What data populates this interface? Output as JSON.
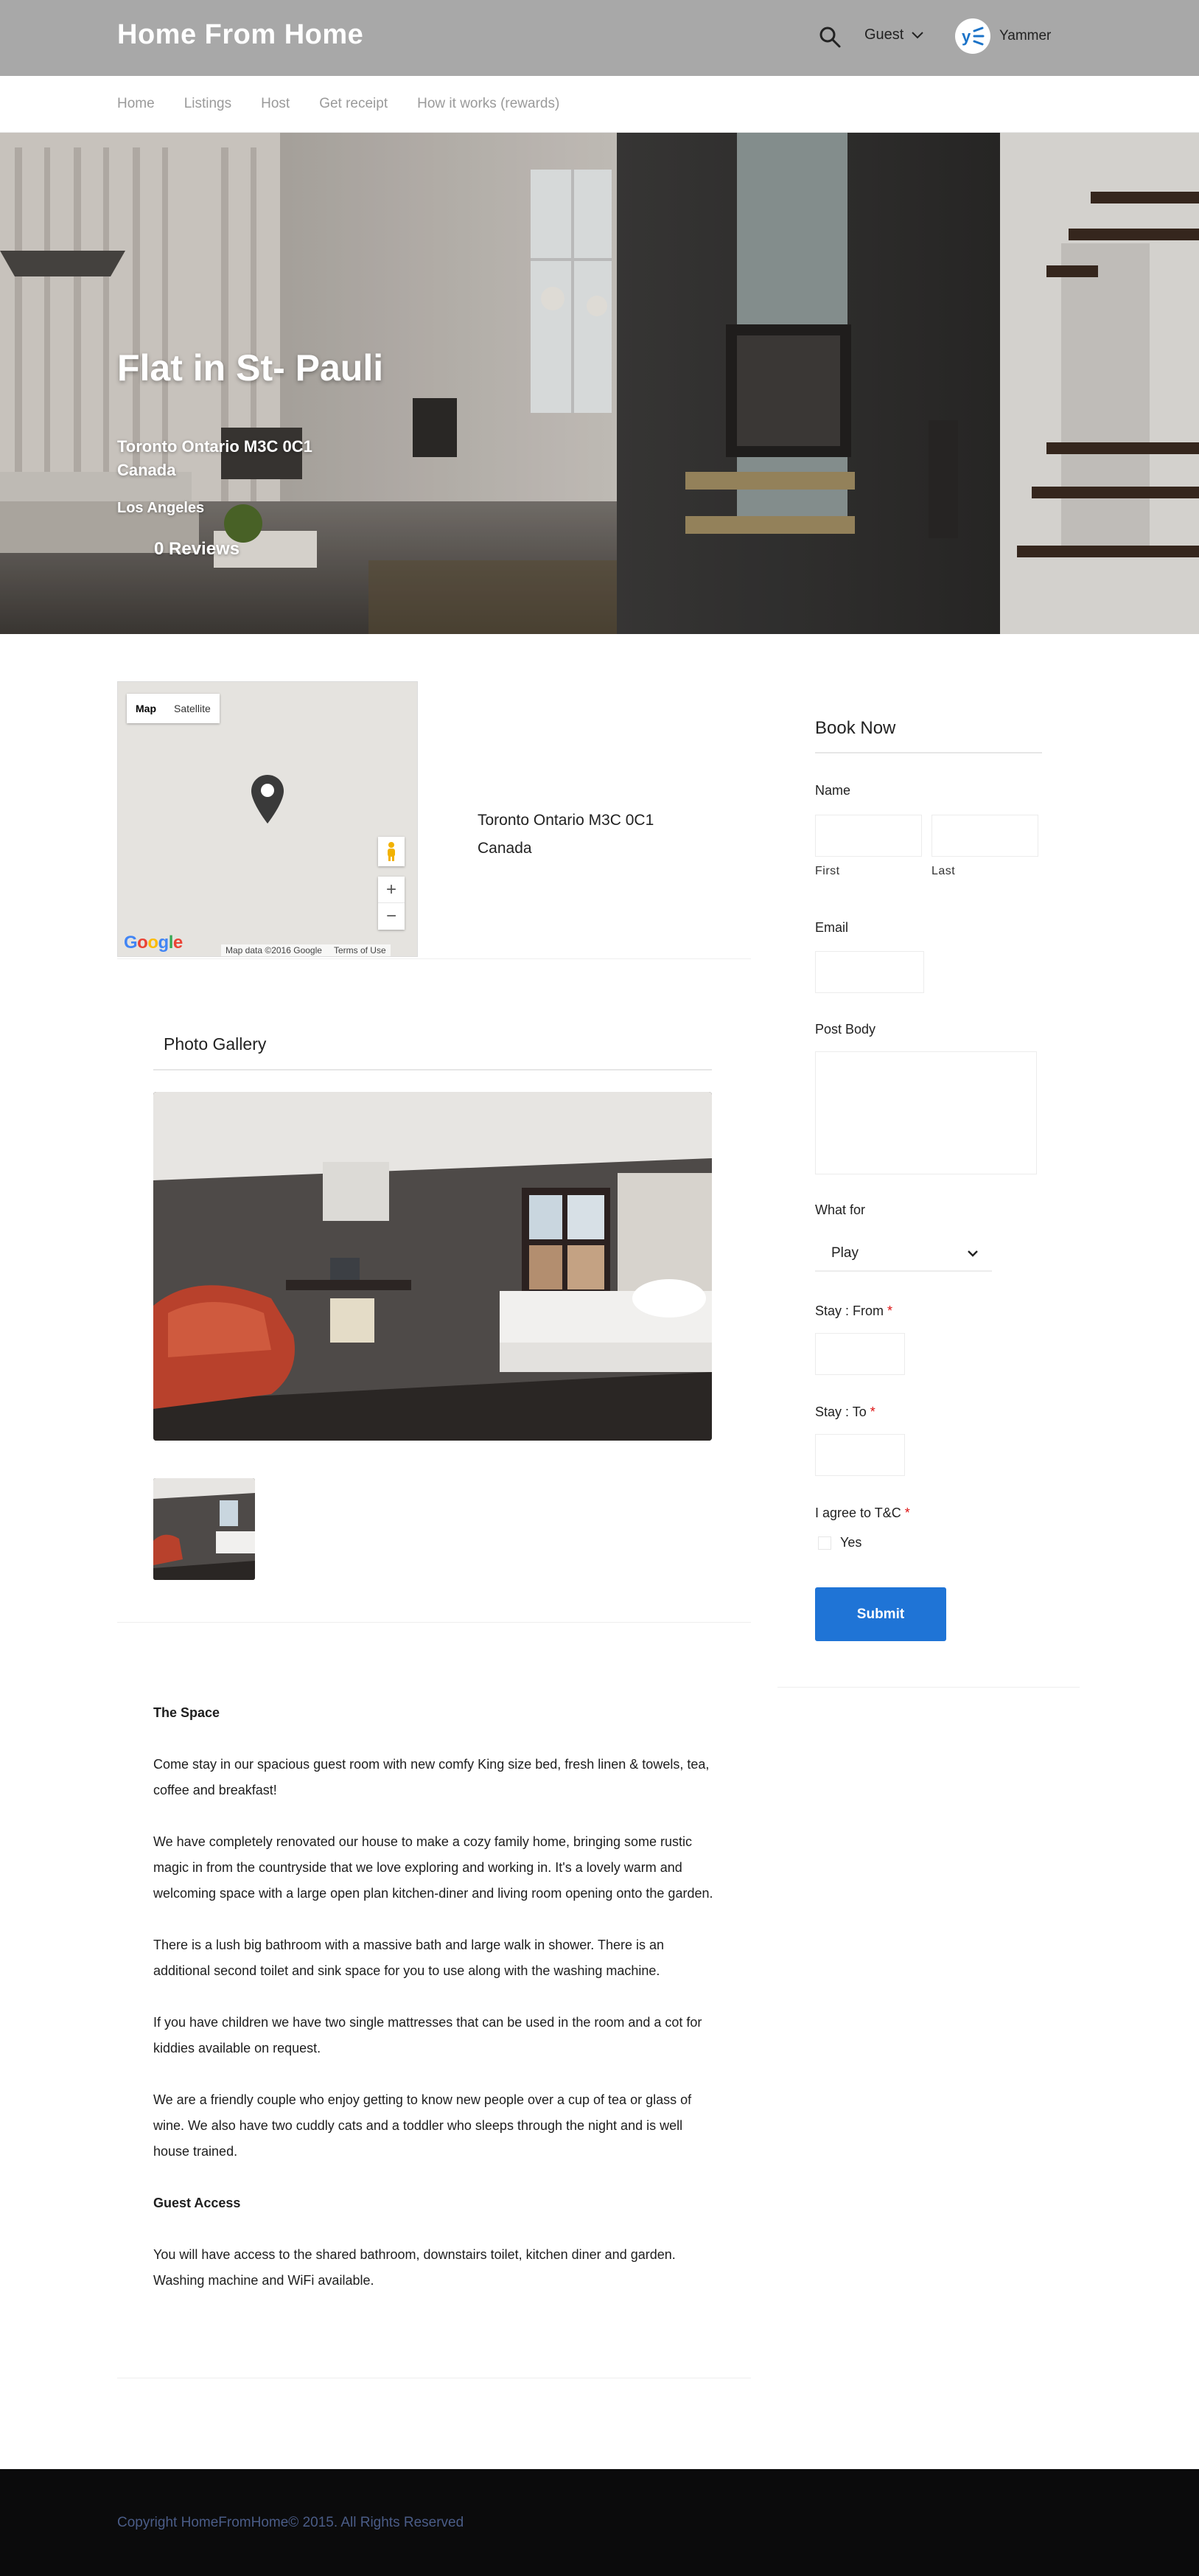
{
  "header": {
    "brand": "Home From Home",
    "guest_label": "Guest",
    "user_initials": "y≤",
    "user_name": "Yammer"
  },
  "nav": {
    "items": [
      {
        "label": "Home"
      },
      {
        "label": "Listings"
      },
      {
        "label": "Host"
      },
      {
        "label": "Get receipt"
      },
      {
        "label": "How it works (rewards)"
      }
    ]
  },
  "hero": {
    "title": "Flat in St- Pauli",
    "address_line1": "Toronto Ontario M3C 0C1",
    "address_line2": "Canada",
    "city": "Los Angeles",
    "reviews": "0 Reviews"
  },
  "map": {
    "type_map": "Map",
    "type_satellite": "Satellite",
    "zoom_in": "+",
    "zoom_out": "−",
    "logo": "Google",
    "attribution": "Map data ©2016 Google",
    "terms": "Terms of Use",
    "address_line1": "Toronto Ontario M3C 0C1",
    "address_line2": "Canada"
  },
  "gallery": {
    "title": "Photo Gallery"
  },
  "description": {
    "space_heading": "The Space",
    "p1": "Come stay in our spacious guest room with new comfy King size bed, fresh linen & towels, tea, coffee and breakfast!",
    "p2": "We have completely renovated our house to make a cozy family home, bringing some rustic magic in from the countryside that we love exploring and working in. It's a lovely warm and welcoming space with a large open plan kitchen-diner and living room opening onto the garden.",
    "p3": "There is a lush big bathroom with a massive bath and large walk in shower. There is an additional second toilet and sink space for you to use along with the washing machine.",
    "p4": "If you have children we have two single mattresses that can be used in the room and a cot for kiddies available on request.",
    "p5": "We are a friendly couple who enjoy getting to know new people over a cup of tea or glass of wine. We also have two cuddly cats and a toddler who sleeps through the night and is well house trained.",
    "access_heading": "Guest Access",
    "p6": "You will have access to the shared bathroom, downstairs toilet, kitchen diner and garden. Washing machine and WiFi available."
  },
  "booking": {
    "title": "Book Now",
    "name_label": "Name",
    "first_label": "First",
    "last_label": "Last",
    "email_label": "Email",
    "post_body_label": "Post Body",
    "what_for_label": "What for",
    "what_for_value": "Play",
    "stay_from_label": "Stay : From",
    "stay_to_label": "Stay : To",
    "tc_label": "I agree to T&C",
    "required_mark": "*",
    "yes_label": "Yes",
    "submit_label": "Submit"
  },
  "footer": {
    "copyright": "Copyright HomeFromHome© 2015. All Rights Reserved"
  },
  "colors": {
    "header_bg": "#a8a8a8",
    "submit_blue": "#1f74d6",
    "footer_bg": "#0b0b0c",
    "footer_text": "#4a5c87"
  }
}
